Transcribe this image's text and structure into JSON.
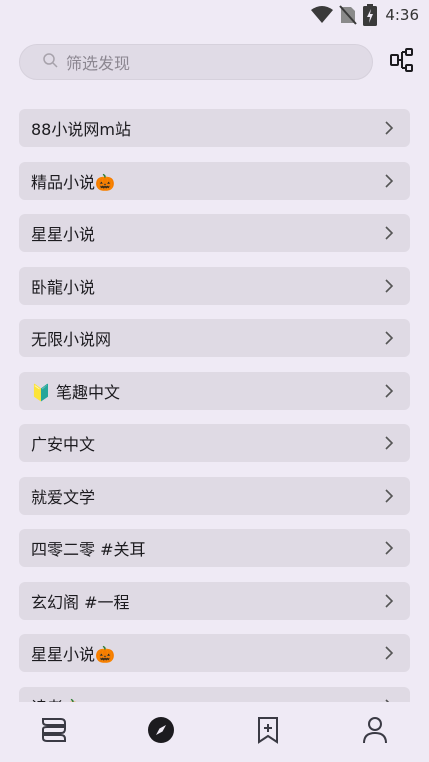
{
  "status": {
    "time": "4:36"
  },
  "search": {
    "placeholder": "筛选发现"
  },
  "sources": [
    {
      "label": "88小说网m站"
    },
    {
      "label": "精品小说🎃"
    },
    {
      "label": "星星小说"
    },
    {
      "label": "卧龍小说"
    },
    {
      "label": "无限小说网"
    },
    {
      "label": "🔰 笔趣中文"
    },
    {
      "label": "广安中文"
    },
    {
      "label": "就爱文学"
    },
    {
      "label": "四零二零 #关耳"
    },
    {
      "label": "玄幻阁 #一程"
    },
    {
      "label": "星星小说🎃"
    },
    {
      "label": "读者🎃"
    }
  ],
  "nav": {
    "items": [
      {
        "icon": "bookshelf-icon"
      },
      {
        "icon": "compass-icon",
        "active": true
      },
      {
        "icon": "bookmark-add-icon"
      },
      {
        "icon": "person-icon"
      }
    ]
  },
  "colors": {
    "background": "#efeaf5",
    "card": "#dfdae4",
    "accent": "#1c1b1f"
  }
}
